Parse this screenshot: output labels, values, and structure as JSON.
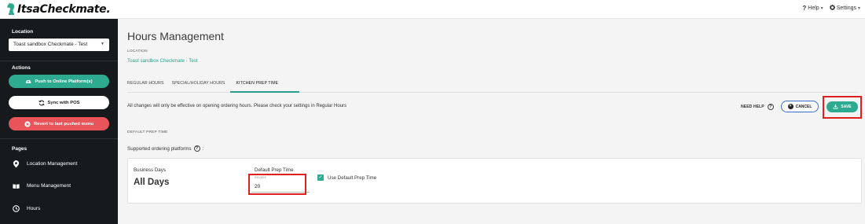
{
  "brand": {
    "name": "ItsaCheckmate."
  },
  "topnav": {
    "help_label": "Help",
    "settings_label": "Settings"
  },
  "sidebar": {
    "location_label": "Location",
    "location_value": "Toast sandbox Checkmate - Test",
    "actions_label": "Actions",
    "actions": [
      {
        "label": "Push to Online Platform(s)",
        "icon": "cloud-upload-icon"
      },
      {
        "label": "Sync with POS",
        "icon": "sync-icon"
      },
      {
        "label": "Revert to last pushed menu",
        "icon": "close-circle-icon"
      }
    ],
    "pages_label": "Pages",
    "pages": [
      {
        "label": "Location Management",
        "icon": "location-pin-icon"
      },
      {
        "label": "Menu Management",
        "icon": "menu-book-icon"
      },
      {
        "label": "Hours",
        "icon": "clock-icon"
      }
    ]
  },
  "main": {
    "title": "Hours Management",
    "location_caption": "LOCATION",
    "location_link": "Toast sandbox Checkmate - Test",
    "tabs": [
      {
        "label": "REGULAR HOURS",
        "active": false
      },
      {
        "label": "SPECIAL/HOLIDAY HOURS",
        "active": false
      },
      {
        "label": "KITCHEN PREP TIME",
        "active": true
      }
    ],
    "notice": "All changes will only be effective on opening ordering hours. Please check your settings in Regular Hours",
    "need_help_label": "NEED HELP",
    "cancel_label": "CANCEL",
    "save_label": "SAVE",
    "section_caption": "DEFAULT PREP TIME",
    "supported_label": "Supported ordering platforms",
    "card": {
      "business_days_label": "Business Days",
      "business_days_value": "All Days",
      "default_prep_label": "Default Prep Time",
      "minutes_caption": "minutes",
      "minutes_value": "20",
      "use_default_label": "Use Default Prep Time",
      "use_default_checked": true
    }
  },
  "colors": {
    "accent": "#2eaa90",
    "danger": "#e8545a",
    "sidebar_bg": "#161a1d",
    "highlight": "#e02020",
    "cancel_border": "#3b6fd4"
  }
}
